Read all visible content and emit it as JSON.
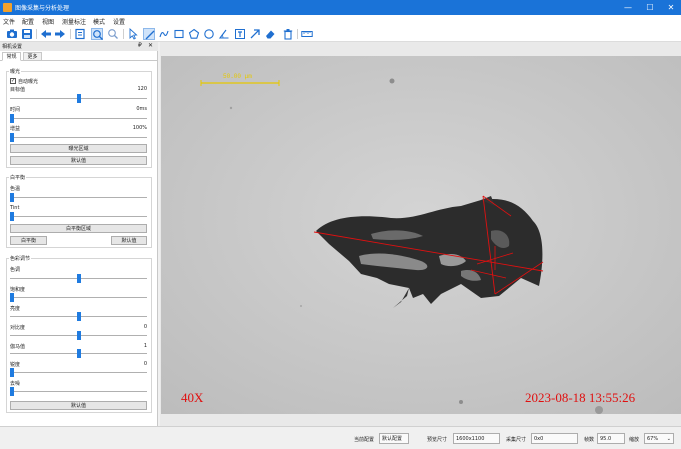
{
  "window": {
    "title": "图像采集与分析处理",
    "controls": [
      "—",
      "☐",
      "✕"
    ]
  },
  "menu": [
    "文件",
    "配置",
    "视图",
    "测量标注",
    "模式",
    "设置"
  ],
  "toolbar": {
    "icons": [
      "camera-icon",
      "save-icon",
      "arrow-left-icon",
      "arrow-right-icon",
      "fit-icon",
      "zoom-in-icon",
      "zoom-out-icon",
      "pointer-icon",
      "line-icon",
      "curve-icon",
      "rectangle-icon",
      "polygon-icon",
      "circle-icon",
      "angle-icon",
      "text-icon",
      "arrow-icon",
      "eraser-icon",
      "delete-icon",
      "ruler-icon"
    ]
  },
  "panel": {
    "title": "相机设置",
    "pin": "₽",
    "close": "✕",
    "tabs": [
      "常规",
      "更多"
    ],
    "exposure": {
      "group_title": "曝光",
      "auto_label": "自动曝光",
      "auto_checked": true,
      "target_label": "目标值",
      "target_value": "120",
      "target_level": 0.5,
      "time_label": "时间",
      "time_value": "0ms",
      "time_level": 0.0,
      "gain_label": "增益",
      "gain_value": "100%",
      "gain_level": 0.0,
      "region_button": "曝光区域",
      "default_button": "默认值"
    },
    "white_balance": {
      "group_title": "白平衡",
      "temp_label": "色温",
      "temp_level": 0.0,
      "tint_label": "Tint",
      "tint_level": 0.0,
      "region_button": "白平衡区域",
      "wb_button": "白平衡",
      "default_button": "默认值"
    },
    "color": {
      "group_title": "色彩调节",
      "hue_label": "色调",
      "hue_level": 0.5,
      "saturation_label": "饱和度",
      "saturation_level": 0.0,
      "brightness_label": "亮度",
      "brightness_level": 0.5,
      "contrast_label": "对比度",
      "contrast_value": "0",
      "contrast_level": 0.5,
      "gamma_label": "伽马值",
      "gamma_value": "1",
      "gamma_level": 0.5,
      "sharpness_label": "锐度",
      "sharpness_value": "0",
      "sharpness_level": 0.0,
      "denoise_label": "去噪",
      "denoise_level": 0.0,
      "default_button": "默认值"
    }
  },
  "image": {
    "scale_label": "50.00 μm",
    "magnification": "40X",
    "timestamp": "2023-08-18  13:55:26",
    "overlay_color": "#e01010",
    "scale_color": "#e6c800"
  },
  "status": {
    "config_label": "当前配置",
    "config_value": "默认配置",
    "preview_label": "预览尺寸",
    "preview_value": "1600x1100",
    "capture_label": "采集尺寸",
    "capture_value": "0x0",
    "fps_label": "帧数",
    "fps_value": "95.0",
    "zoom_label": "缩放",
    "zoom_value": "67%"
  }
}
